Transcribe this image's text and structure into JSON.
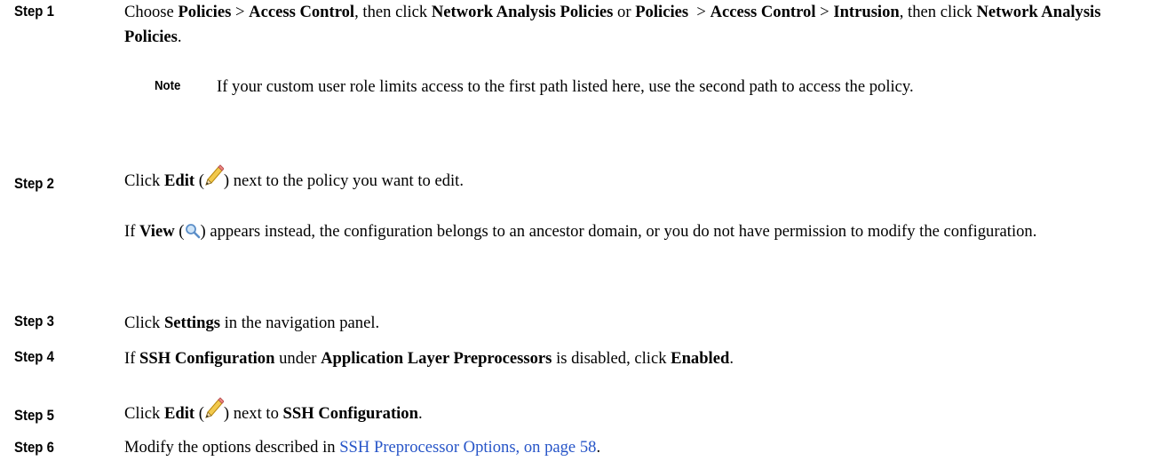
{
  "steps": [
    {
      "label": "Step 1"
    },
    {
      "label": "Step 2"
    },
    {
      "label": "Step 3"
    },
    {
      "label": "Step 4"
    },
    {
      "label": "Step 5"
    },
    {
      "label": "Step 6"
    }
  ],
  "step1": {
    "choose": "Choose",
    "policies": "Policies",
    "sep": ">",
    "access_control": "Access Control",
    "then_click": ", then click",
    "nap": "Network Analysis Policies",
    "or": "or",
    "intrusion": "Intrusion",
    "end": "."
  },
  "note": {
    "label": "Note",
    "text": "If your custom user role limits access to the first path listed here, use the second path to access the policy."
  },
  "step2": {
    "click": "Click",
    "edit": "Edit",
    "open_paren": "(",
    "close_paren": ") next to the policy you want to edit.",
    "if": "If",
    "view": "View",
    "view_rest": ") appears instead, the configuration belongs to an ancestor domain, or you do not have permission to modify the configuration."
  },
  "step3": {
    "click": "Click",
    "settings": "Settings",
    "rest": "in the navigation panel."
  },
  "step4": {
    "if": "If",
    "ssh_config": "SSH Configuration",
    "under": "under",
    "app_layer": "Application Layer Preprocessors",
    "is_disabled": "is disabled, click",
    "enabled": "Enabled",
    "end": "."
  },
  "step5": {
    "click": "Click",
    "edit": "Edit",
    "next_to": ") next to",
    "ssh_config": "SSH Configuration",
    "end": "."
  },
  "step6": {
    "modify": "Modify the options described in",
    "link": "SSH Preprocessor Options, on page 58",
    "end": "."
  },
  "icons": {
    "edit": "pencil-icon",
    "view": "magnifier-icon"
  }
}
